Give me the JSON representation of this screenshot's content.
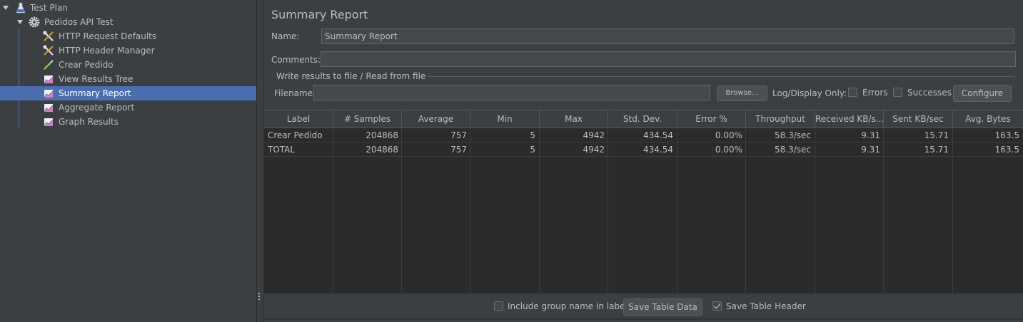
{
  "tree": {
    "items": [
      {
        "label": "Test Plan",
        "icon": "flask-icon"
      },
      {
        "label": "Pedidos API Test",
        "icon": "gear-icon"
      },
      {
        "label": "HTTP Request Defaults",
        "icon": "wrench-icon"
      },
      {
        "label": "HTTP Header Manager",
        "icon": "wrench-icon"
      },
      {
        "label": "Crear Pedido",
        "icon": "pipette-icon"
      },
      {
        "label": "View Results Tree",
        "icon": "chart-icon"
      },
      {
        "label": "Summary Report",
        "icon": "chart-icon"
      },
      {
        "label": "Aggregate Report",
        "icon": "chart-icon"
      },
      {
        "label": "Graph Results",
        "icon": "chart-icon"
      }
    ],
    "selected": "Summary Report"
  },
  "panel": {
    "title": "Summary Report",
    "name_label": "Name:",
    "name_value": "Summary Report",
    "comments_label": "Comments:",
    "comments_value": "",
    "file_group_title": "Write results to file / Read from file",
    "filename_label": "Filename",
    "filename_value": "",
    "browse_label": "Browse...",
    "log_display_label": "Log/Display Only:",
    "errors_label": "Errors",
    "successes_label": "Successes",
    "configure_label": "Configure"
  },
  "table": {
    "headers": [
      "Label",
      "# Samples",
      "Average",
      "Min",
      "Max",
      "Std. Dev.",
      "Error %",
      "Throughput",
      "Received KB/s...",
      "Sent KB/sec",
      "Avg. Bytes"
    ],
    "rows": [
      [
        "Crear Pedido",
        "204868",
        "757",
        "5",
        "4942",
        "434.54",
        "0.00%",
        "58.3/sec",
        "9.31",
        "15.71",
        "163.5"
      ],
      [
        "TOTAL",
        "204868",
        "757",
        "5",
        "4942",
        "434.54",
        "0.00%",
        "58.3/sec",
        "9.31",
        "15.71",
        "163.5"
      ]
    ]
  },
  "footer": {
    "include_group_label": "Include group name in label?",
    "include_group_checked": false,
    "save_table_data_label": "Save Table Data",
    "save_table_header_label": "Save Table Header",
    "save_table_header_checked": true
  },
  "colors": {
    "background": "#3c3f41",
    "table_background": "#2b2b2b",
    "selection": "#4b6eaf",
    "text": "#bbbbbb"
  }
}
